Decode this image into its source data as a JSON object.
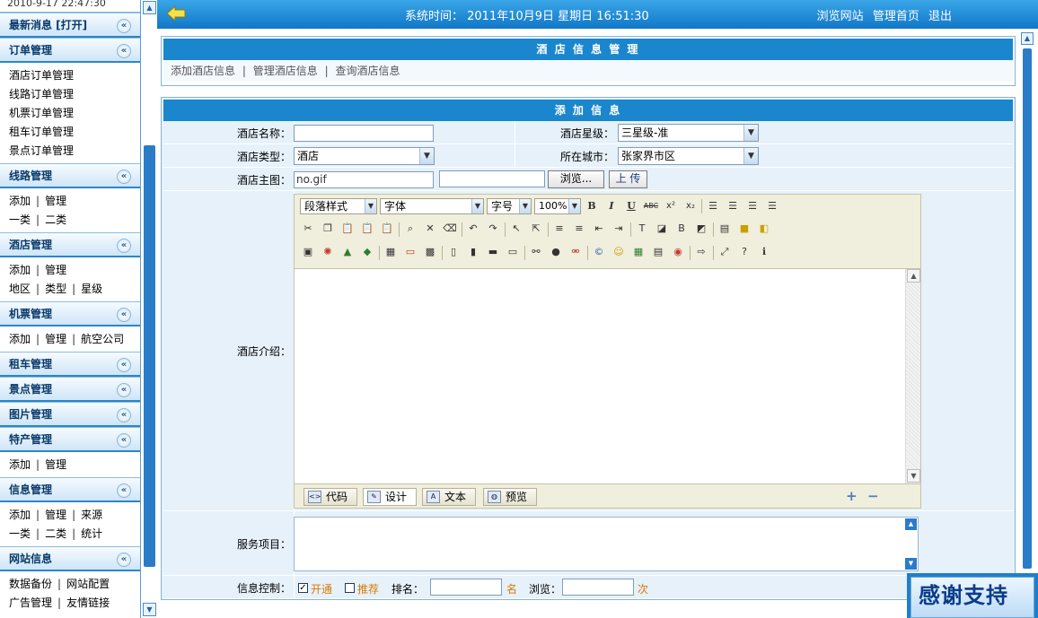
{
  "sidebar": {
    "datetime": "2010-9-17 22:47:30",
    "sections": [
      {
        "title": "最新消息 [打开]",
        "lines": []
      },
      {
        "title": "订单管理",
        "lines": [
          [
            "酒店订单管理"
          ],
          [
            "线路订单管理"
          ],
          [
            "机票订单管理"
          ],
          [
            "租车订单管理"
          ],
          [
            "景点订单管理"
          ]
        ]
      },
      {
        "title": "线路管理",
        "lines": [
          [
            "添加",
            "管理"
          ],
          [
            "一类",
            "二类"
          ]
        ]
      },
      {
        "title": "酒店管理",
        "lines": [
          [
            "添加",
            "管理"
          ],
          [
            "地区",
            "类型",
            "星级"
          ]
        ]
      },
      {
        "title": "机票管理",
        "lines": [
          [
            "添加",
            "管理",
            "航空公司"
          ]
        ]
      },
      {
        "title": "租车管理",
        "lines": []
      },
      {
        "title": "景点管理",
        "lines": []
      },
      {
        "title": "图片管理",
        "lines": []
      },
      {
        "title": "特产管理",
        "lines": [
          [
            "添加",
            "管理"
          ]
        ]
      },
      {
        "title": "信息管理",
        "lines": [
          [
            "添加",
            "管理",
            "来源"
          ],
          [
            "一类",
            "二类",
            "统计"
          ]
        ]
      },
      {
        "title": "网站信息",
        "lines": [
          [
            "数据备份",
            "网站配置"
          ],
          [
            "广告管理",
            "友情链接"
          ]
        ]
      }
    ],
    "separator": "|",
    "collapse_glyph": "«"
  },
  "header": {
    "system_time": "系统时间： 2011年10月9日 星期日 16:51:30",
    "links": [
      "浏览网站",
      "管理首页",
      "退出"
    ]
  },
  "top_panel": {
    "title": "酒 店 信 息 管 理",
    "links": [
      "添加酒店信息",
      "管理酒店信息",
      "查询酒店信息"
    ],
    "separator": "|"
  },
  "form": {
    "title": "添 加 信 息",
    "hotel_name_label": "酒店名称：",
    "hotel_name_value": "",
    "star_label": "酒店星级：",
    "star_value": "三星级-准",
    "type_label": "酒店类型：",
    "type_value": "酒店",
    "city_label": "所在城市：",
    "city_value": "张家界市区",
    "image_label": "酒店主图：",
    "image_value": "no.gif",
    "file_value": "",
    "browse_label": "浏览...",
    "upload_label": "上 传",
    "intro_label": "酒店介绍：",
    "service_label": "服务项目：",
    "control_label": "信息控制：",
    "open_label": "开通",
    "open_checked": true,
    "recommend_label": "推荐",
    "recommend_checked": false,
    "rank_label": "排名：",
    "rank_value": "",
    "rank_unit": "名",
    "views_label": "浏览：",
    "views_value": "",
    "views_unit": "次"
  },
  "editor": {
    "paragraph_style": "段落样式",
    "font": "字体",
    "font_size": "字号",
    "zoom": "100%",
    "tabs": [
      "代码",
      "设计",
      "文本",
      "预览"
    ],
    "active_tab": "设计",
    "text_controls": [
      "B",
      "I",
      "U",
      "ABC",
      "x²",
      "x₂"
    ]
  },
  "badge": {
    "text": "感谢支持"
  }
}
